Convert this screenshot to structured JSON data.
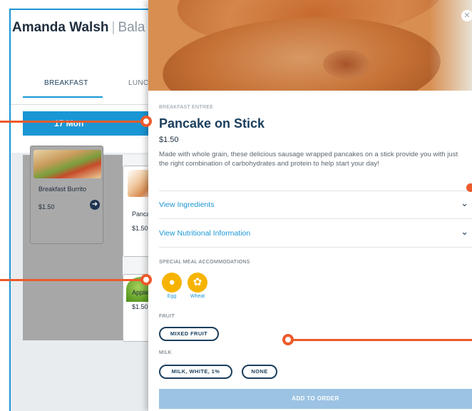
{
  "header": {
    "user_name": "Amanda Walsh",
    "separator": "|",
    "subtitle_partial": "Bala"
  },
  "tabs": [
    {
      "label": "BREAKFAST",
      "active": true
    },
    {
      "label": "LUNC",
      "active": false
    }
  ],
  "day": {
    "label": "17 Mon"
  },
  "menu_cards": [
    {
      "name": "Breakfast Burrito",
      "price": "$1.50",
      "arrow_icon": "arrow-right-circle-icon"
    },
    {
      "name": "Panca",
      "price": "$1.50"
    },
    {
      "name": "Apple",
      "price": "$1.50"
    }
  ],
  "modal": {
    "close_icon": "close-icon",
    "category": "BREAKFAST ENTREE",
    "title": "Pancake on Stick",
    "price": "$1.50",
    "description": "Made with whole grain, these delicious sausage wrapped pancakes on a stick provide you with just the right combination of carbohydrates and protein to help start your day!",
    "accordions": [
      {
        "label": "View Ingredients",
        "icon": "chevron-down-icon"
      },
      {
        "label": "View Nutritional Information",
        "icon": "chevron-down-icon"
      }
    ],
    "accommodations": {
      "label": "SPECIAL MEAL ACCOMMODATIONS",
      "items": [
        {
          "label": "Egg",
          "icon": "egg-icon"
        },
        {
          "label": "Wheat",
          "icon": "wheat-icon"
        }
      ]
    },
    "fruit": {
      "label": "FRUIT",
      "options": [
        "MIXED FRUIT"
      ]
    },
    "milk": {
      "label": "MILK",
      "options": [
        "MILK, WHITE, 1%",
        "NONE"
      ]
    },
    "add_button": "ADD TO ORDER"
  },
  "colors": {
    "primary_blue": "#1a96d4",
    "navy": "#1a3e5c",
    "allergen_yellow": "#f6b400",
    "callout_orange": "#ed5a2b",
    "add_button_disabled": "#9cc3e3"
  }
}
